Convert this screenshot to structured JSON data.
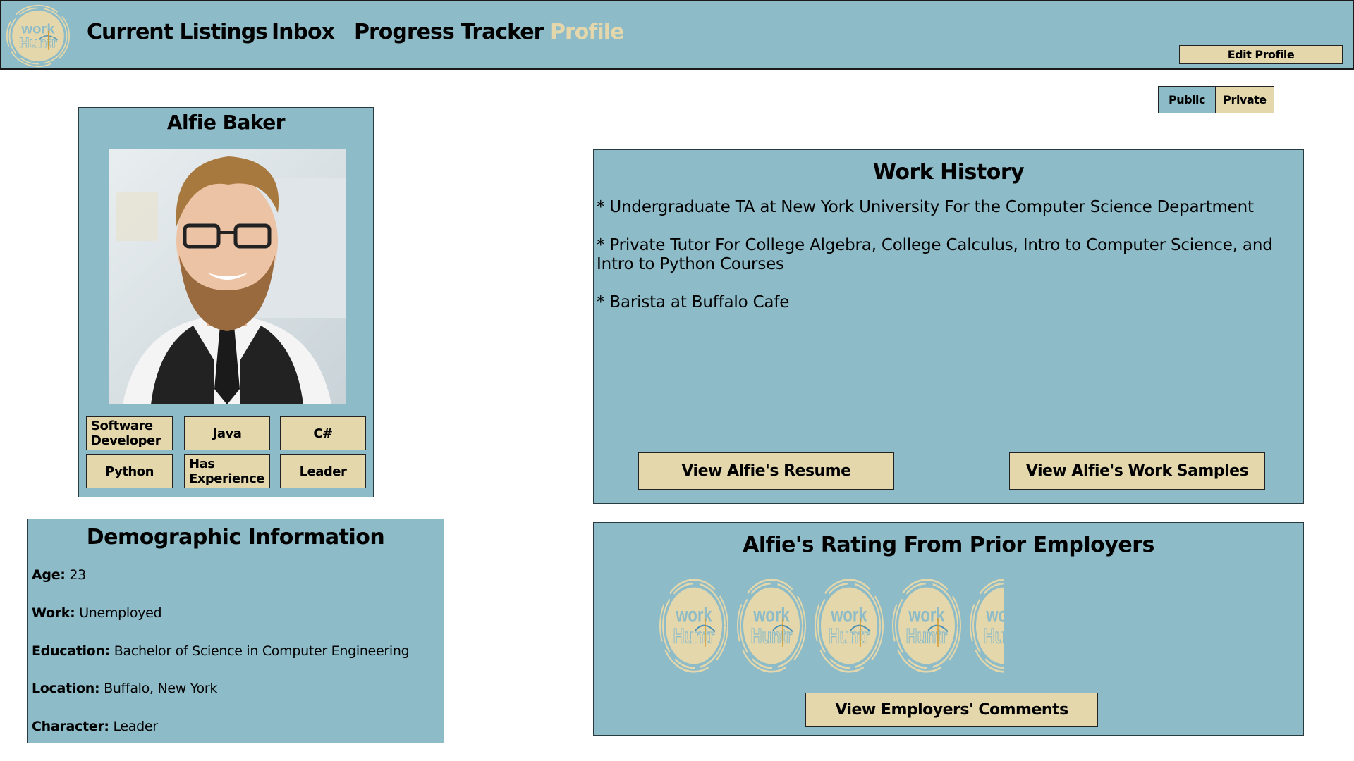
{
  "nav": {
    "logo_text": [
      "work",
      "Huntr"
    ],
    "items": [
      "Current Listings",
      "Inbox",
      "Progress Tracker",
      "Profile"
    ],
    "active": "Profile",
    "edit_profile": "Edit Profile"
  },
  "visibility": {
    "public": "Public",
    "private": "Private",
    "selected": "Public"
  },
  "profile": {
    "name": "Alfie Baker",
    "tags": [
      "Software Developer",
      "Java",
      "C#",
      "Python",
      "Has Experience",
      "Leader"
    ]
  },
  "demographic": {
    "title": "Demographic Information",
    "fields": [
      {
        "label": "Age:",
        "value": "23"
      },
      {
        "label": "Work:",
        "value": "Unemployed"
      },
      {
        "label": "Education:",
        "value": "Bachelor of Science in Computer Engineering"
      },
      {
        "label": "Location:",
        "value": "Buffalo, New York"
      },
      {
        "label": "Character:",
        "value": "Leader"
      }
    ]
  },
  "work_history": {
    "title": "Work History",
    "items": [
      "* Undergraduate TA at New York University For the Computer Science Department",
      "* Private Tutor For College Algebra, College Calculus, Intro to Computer Science, and Intro to Python Courses",
      "* Barista at Buffalo Cafe"
    ],
    "resume_button": "View Alfie's Resume",
    "samples_button": "View Alfie's Work Samples"
  },
  "rating": {
    "title": "Alfie's Rating From Prior Employers",
    "value": 4.5,
    "max": 5,
    "comments_button": "View Employers' Comments"
  },
  "colors": {
    "panel": "#8dbbc8",
    "accent": "#e3d7ab",
    "active_nav": "#e3d7ab"
  }
}
